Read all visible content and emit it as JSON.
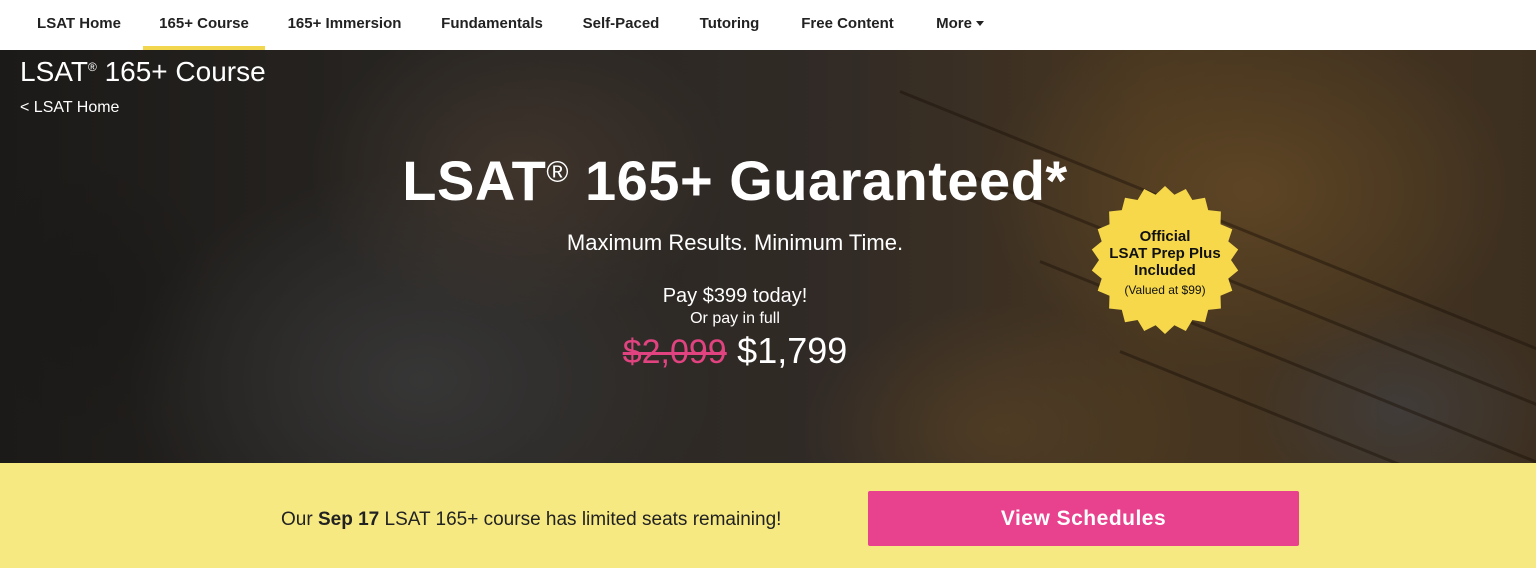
{
  "nav": {
    "items": [
      {
        "label": "LSAT Home"
      },
      {
        "label": "165+ Course"
      },
      {
        "label": "165+ Immersion"
      },
      {
        "label": "Fundamentals"
      },
      {
        "label": "Self-Paced"
      },
      {
        "label": "Tutoring"
      },
      {
        "label": "Free Content"
      },
      {
        "label": "More"
      }
    ],
    "active_index": 1,
    "accent_color": "#f2d74e"
  },
  "hero": {
    "page_title": "LSAT",
    "page_title_reg": "®",
    "page_title_rest": " 165+ Course",
    "back_link": "< LSAT Home",
    "headline": "LSAT",
    "headline_reg": "®",
    "headline_rest": " 165+ Guaranteed*",
    "tagline": "Maximum Results. Minimum Time.",
    "pay_today": "Pay $399 today!",
    "pay_full": "Or pay in full",
    "old_price": "$2,099",
    "new_price": "$1,799",
    "old_price_color": "#e0437f"
  },
  "badge": {
    "line1": "Official",
    "line2": "LSAT Prep Plus",
    "line3": "Included",
    "note": "(Valued at $99)",
    "color": "#f6d84a"
  },
  "promo": {
    "text_before": "Our ",
    "text_bold": "Sep 17",
    "text_after": " LSAT 165+ course has limited seats remaining!",
    "cta_label": "View Schedules",
    "background": "#f6e981",
    "cta_color": "#e8418e"
  }
}
